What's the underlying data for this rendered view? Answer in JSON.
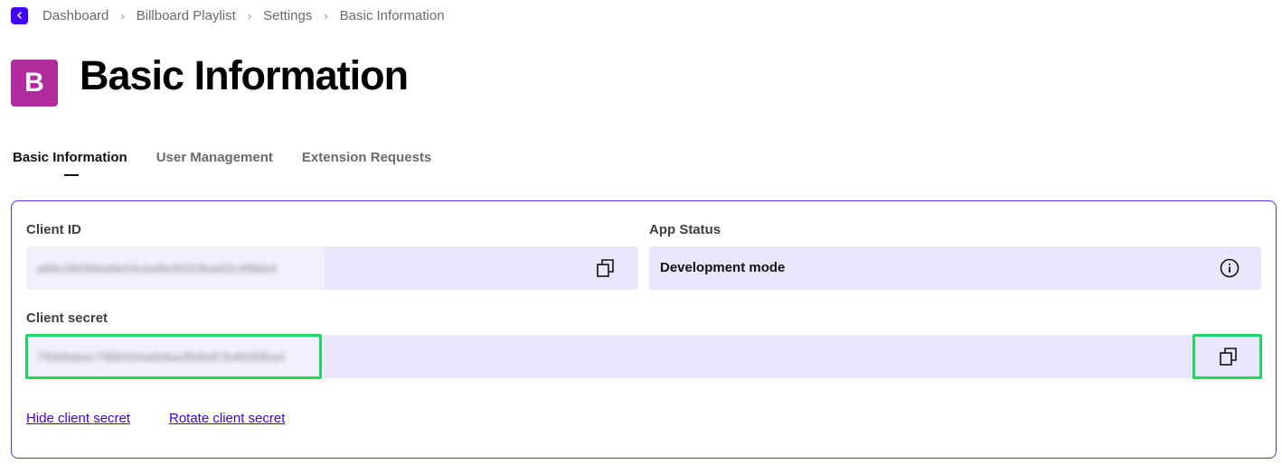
{
  "breadcrumb": {
    "items": [
      "Dashboard",
      "Billboard Playlist",
      "Settings",
      "Basic Information"
    ]
  },
  "app": {
    "avatar_letter": "B",
    "title": "Basic Information",
    "avatar_color": "#b12a9e"
  },
  "tabs": [
    {
      "label": "Basic Information",
      "active": true
    },
    {
      "label": "User Management",
      "active": false
    },
    {
      "label": "Extension Requests",
      "active": false
    }
  ],
  "client_id": {
    "label": "Client ID",
    "value": "a88c0fd3b6a9e04cbe8e9020fea92c4f6bb4"
  },
  "app_status": {
    "label": "App Status",
    "value": "Development mode"
  },
  "client_secret": {
    "label": "Client secret",
    "value": "7f0d9abec7988494a9eba4fb8e87b4605fba4"
  },
  "links": {
    "hide_secret": "Hide client secret",
    "rotate_secret": "Rotate client secret"
  },
  "colors": {
    "accent": "#4100f4",
    "field_bg": "#e9e5fb",
    "highlight": "#1ed760"
  },
  "icons": [
    "chevron-left-icon",
    "chevron-right-icon",
    "copy-icon",
    "info-icon"
  ]
}
